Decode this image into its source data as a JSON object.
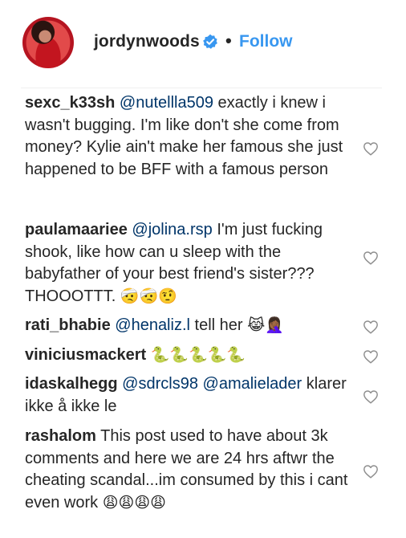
{
  "post": {
    "username": "jordynwoods",
    "separator": "•",
    "follow_label": "Follow"
  },
  "comments": [
    {
      "username": "sexc_k33sh",
      "mentions": [
        "@nutellla509"
      ],
      "text": " exactly i knew i wasn't bugging. I'm like don't she come from money? Kylie ain't make her famous she just happened to be BFF with a famous person"
    },
    {
      "username": "paulamaariee",
      "mentions": [
        "@jolina.rsp"
      ],
      "text": " I'm just fucking shook, like how can u sleep with the babyfather of your best friend's sister??? THOOOTTT.",
      "emoji": "🤕🤕🤨"
    },
    {
      "username": "rati_bhabie",
      "mentions": [
        "@henaliz.l"
      ],
      "text": " tell her",
      "emoji": "😹🤦🏾‍♀️"
    },
    {
      "username": "viniciusmackert",
      "mentions": [],
      "text": "",
      "emoji": "🐍🐍🐍🐍🐍"
    },
    {
      "username": "idaskalhegg",
      "mentions": [
        "@sdrcls98",
        "@amalielader"
      ],
      "text": " klarer ikke å ikke le"
    },
    {
      "username": "rashalom",
      "mentions": [],
      "text": " This post used to have about 3k comments and here we are 24 hrs aftwr the cheating scandal...im consumed by this i cant even work",
      "emoji": "😩😩😩😩"
    }
  ],
  "colors": {
    "follow": "#3897f0",
    "mention": "#003569",
    "text": "#262626",
    "verified": "#3897f0"
  },
  "icons": {
    "verified": "verified-badge-icon",
    "like": "heart-outline-icon"
  }
}
